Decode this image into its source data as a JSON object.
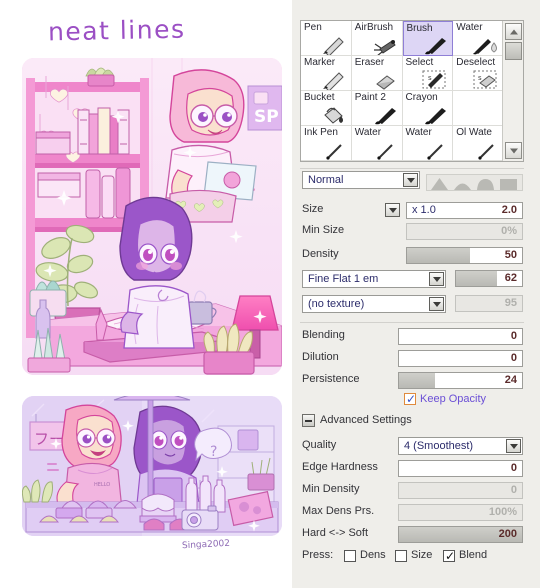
{
  "artwork": {
    "title": "neat lines",
    "signature": "Singa2002",
    "top_panel_name": "bedroom-scene-illustration",
    "bottom_panel_name": "bakery-stall-illustration",
    "palette": {
      "pink": "#f5a8d8",
      "hot_pink": "#ef6fc0",
      "lavender": "#d9b8f0",
      "purple": "#9b59c7",
      "deep_purple": "#7b3fa8",
      "cream": "#f7f0d8",
      "sage": "#cfd9a8",
      "mint": "#bfe3dd",
      "white": "#fdfbff",
      "outline": "#b05ec4"
    }
  },
  "panel": {
    "brush_grid": {
      "name": "brush-tool-grid",
      "tools": [
        {
          "label": "Pen",
          "icon": "pen-icon",
          "selected": false
        },
        {
          "label": "AirBrush",
          "icon": "airbrush-icon",
          "selected": false
        },
        {
          "label": "Brush",
          "icon": "brush-icon",
          "selected": true
        },
        {
          "label": "Water",
          "icon": "water-icon",
          "selected": false
        },
        {
          "label": "Marker",
          "icon": "marker-icon",
          "selected": false
        },
        {
          "label": "Eraser",
          "icon": "eraser-icon",
          "selected": false
        },
        {
          "label": "Select",
          "icon": "select-icon",
          "selected": false
        },
        {
          "label": "Deselect",
          "icon": "deselect-icon",
          "selected": false
        },
        {
          "label": "Bucket",
          "icon": "bucket-icon",
          "selected": false
        },
        {
          "label": "Paint 2",
          "icon": "paint-icon",
          "selected": false
        },
        {
          "label": "Crayon",
          "icon": "crayon-icon",
          "selected": false
        },
        {
          "label": "",
          "icon": "",
          "selected": false
        },
        {
          "label": "Ink Pen",
          "icon": "inkpen-icon",
          "selected": false
        },
        {
          "label": "Water",
          "icon": "water2-icon",
          "selected": false
        },
        {
          "label": "Water",
          "icon": "water3-icon",
          "selected": false
        },
        {
          "label": "Ol Wate",
          "icon": "oilwater-icon",
          "selected": false
        }
      ]
    },
    "blend_mode": {
      "label": "Normal",
      "shapes": [
        "sharp-triangle",
        "round-dome",
        "trapezoid",
        "flat-square"
      ]
    },
    "size": {
      "label": "Size",
      "multiplier": "x 1.0",
      "value": "2.0"
    },
    "min_size": {
      "label": "Min Size",
      "value": "0%",
      "disabled": true
    },
    "density": {
      "label": "Density",
      "value": "50",
      "percent": 55
    },
    "brush_shape": {
      "label": "Fine Flat 1 em",
      "value": "62",
      "percent": 62
    },
    "texture": {
      "label": "(no texture)",
      "value": "95",
      "disabled": true,
      "percent": 0
    },
    "blending": {
      "label": "Blending",
      "value": "0",
      "percent": 0
    },
    "dilution": {
      "label": "Dilution",
      "value": "0",
      "percent": 0
    },
    "persistence": {
      "label": "Persistence",
      "value": "24",
      "percent": 24
    },
    "keep_opacity": {
      "label": "Keep Opacity",
      "checked": true
    },
    "advanced": {
      "header": "Advanced Settings",
      "expanded": true,
      "quality": {
        "label": "Quality",
        "value": "4 (Smoothest)"
      },
      "edge_hardness": {
        "label": "Edge Hardness",
        "value": "0",
        "percent": 0
      },
      "min_density": {
        "label": "Min Density",
        "value": "0",
        "disabled": true,
        "percent": 0
      },
      "max_dens_prs": {
        "label": "Max Dens Prs.",
        "value": "100%",
        "disabled": true,
        "percent": 0
      },
      "hard_soft": {
        "label": "Hard <-> Soft",
        "value": "200",
        "percent": 100
      },
      "press": {
        "label": "Press:",
        "options": [
          {
            "label": "Dens",
            "checked": false
          },
          {
            "label": "Size",
            "checked": false
          },
          {
            "label": "Blend",
            "checked": true
          }
        ]
      }
    }
  }
}
